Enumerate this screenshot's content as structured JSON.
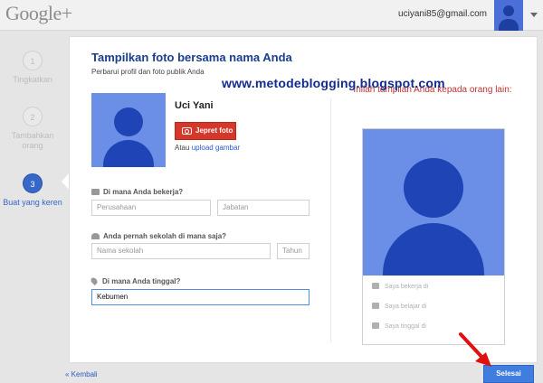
{
  "header": {
    "logo": "Google+",
    "email": "uciyani85@gmail.com"
  },
  "steps": [
    {
      "number": "1",
      "label": "Tingkatkan"
    },
    {
      "number": "2",
      "label": "Tambahkan orang"
    },
    {
      "number": "3",
      "label": "Buat yang keren"
    }
  ],
  "card": {
    "title": "Tampilkan foto bersama nama Anda",
    "subtitle": "Perbarui profil dan foto publik Anda",
    "user_name": "Uci Yani",
    "photo_button": "Jepret foto",
    "or_text": "Atau",
    "upload_link": "upload gambar",
    "work_question": "Di mana Anda bekerja?",
    "company_placeholder": "Perusahaan",
    "position_placeholder": "Jabatan",
    "school_question": "Anda pernah sekolah di mana saja?",
    "school_placeholder": "Nama sekolah",
    "year_placeholder": "Tahun",
    "location_question": "Di mana Anda tinggal?",
    "location_value": "Kebumen"
  },
  "preview": {
    "title": "Inilah tampilan Anda kepada orang lain:",
    "rows": [
      "Saya bekerja di",
      "Saya belajar di",
      "Saya tinggal di"
    ]
  },
  "watermark": "www.metodeblogging.blogspot.com",
  "footer": {
    "back": "« Kembali",
    "done": "Selesai"
  },
  "colors": {
    "accent_blue": "#3568c9",
    "photo_button_red": "#d6372b",
    "preview_title_red": "#bb3333",
    "arrow_red": "#e01010"
  }
}
